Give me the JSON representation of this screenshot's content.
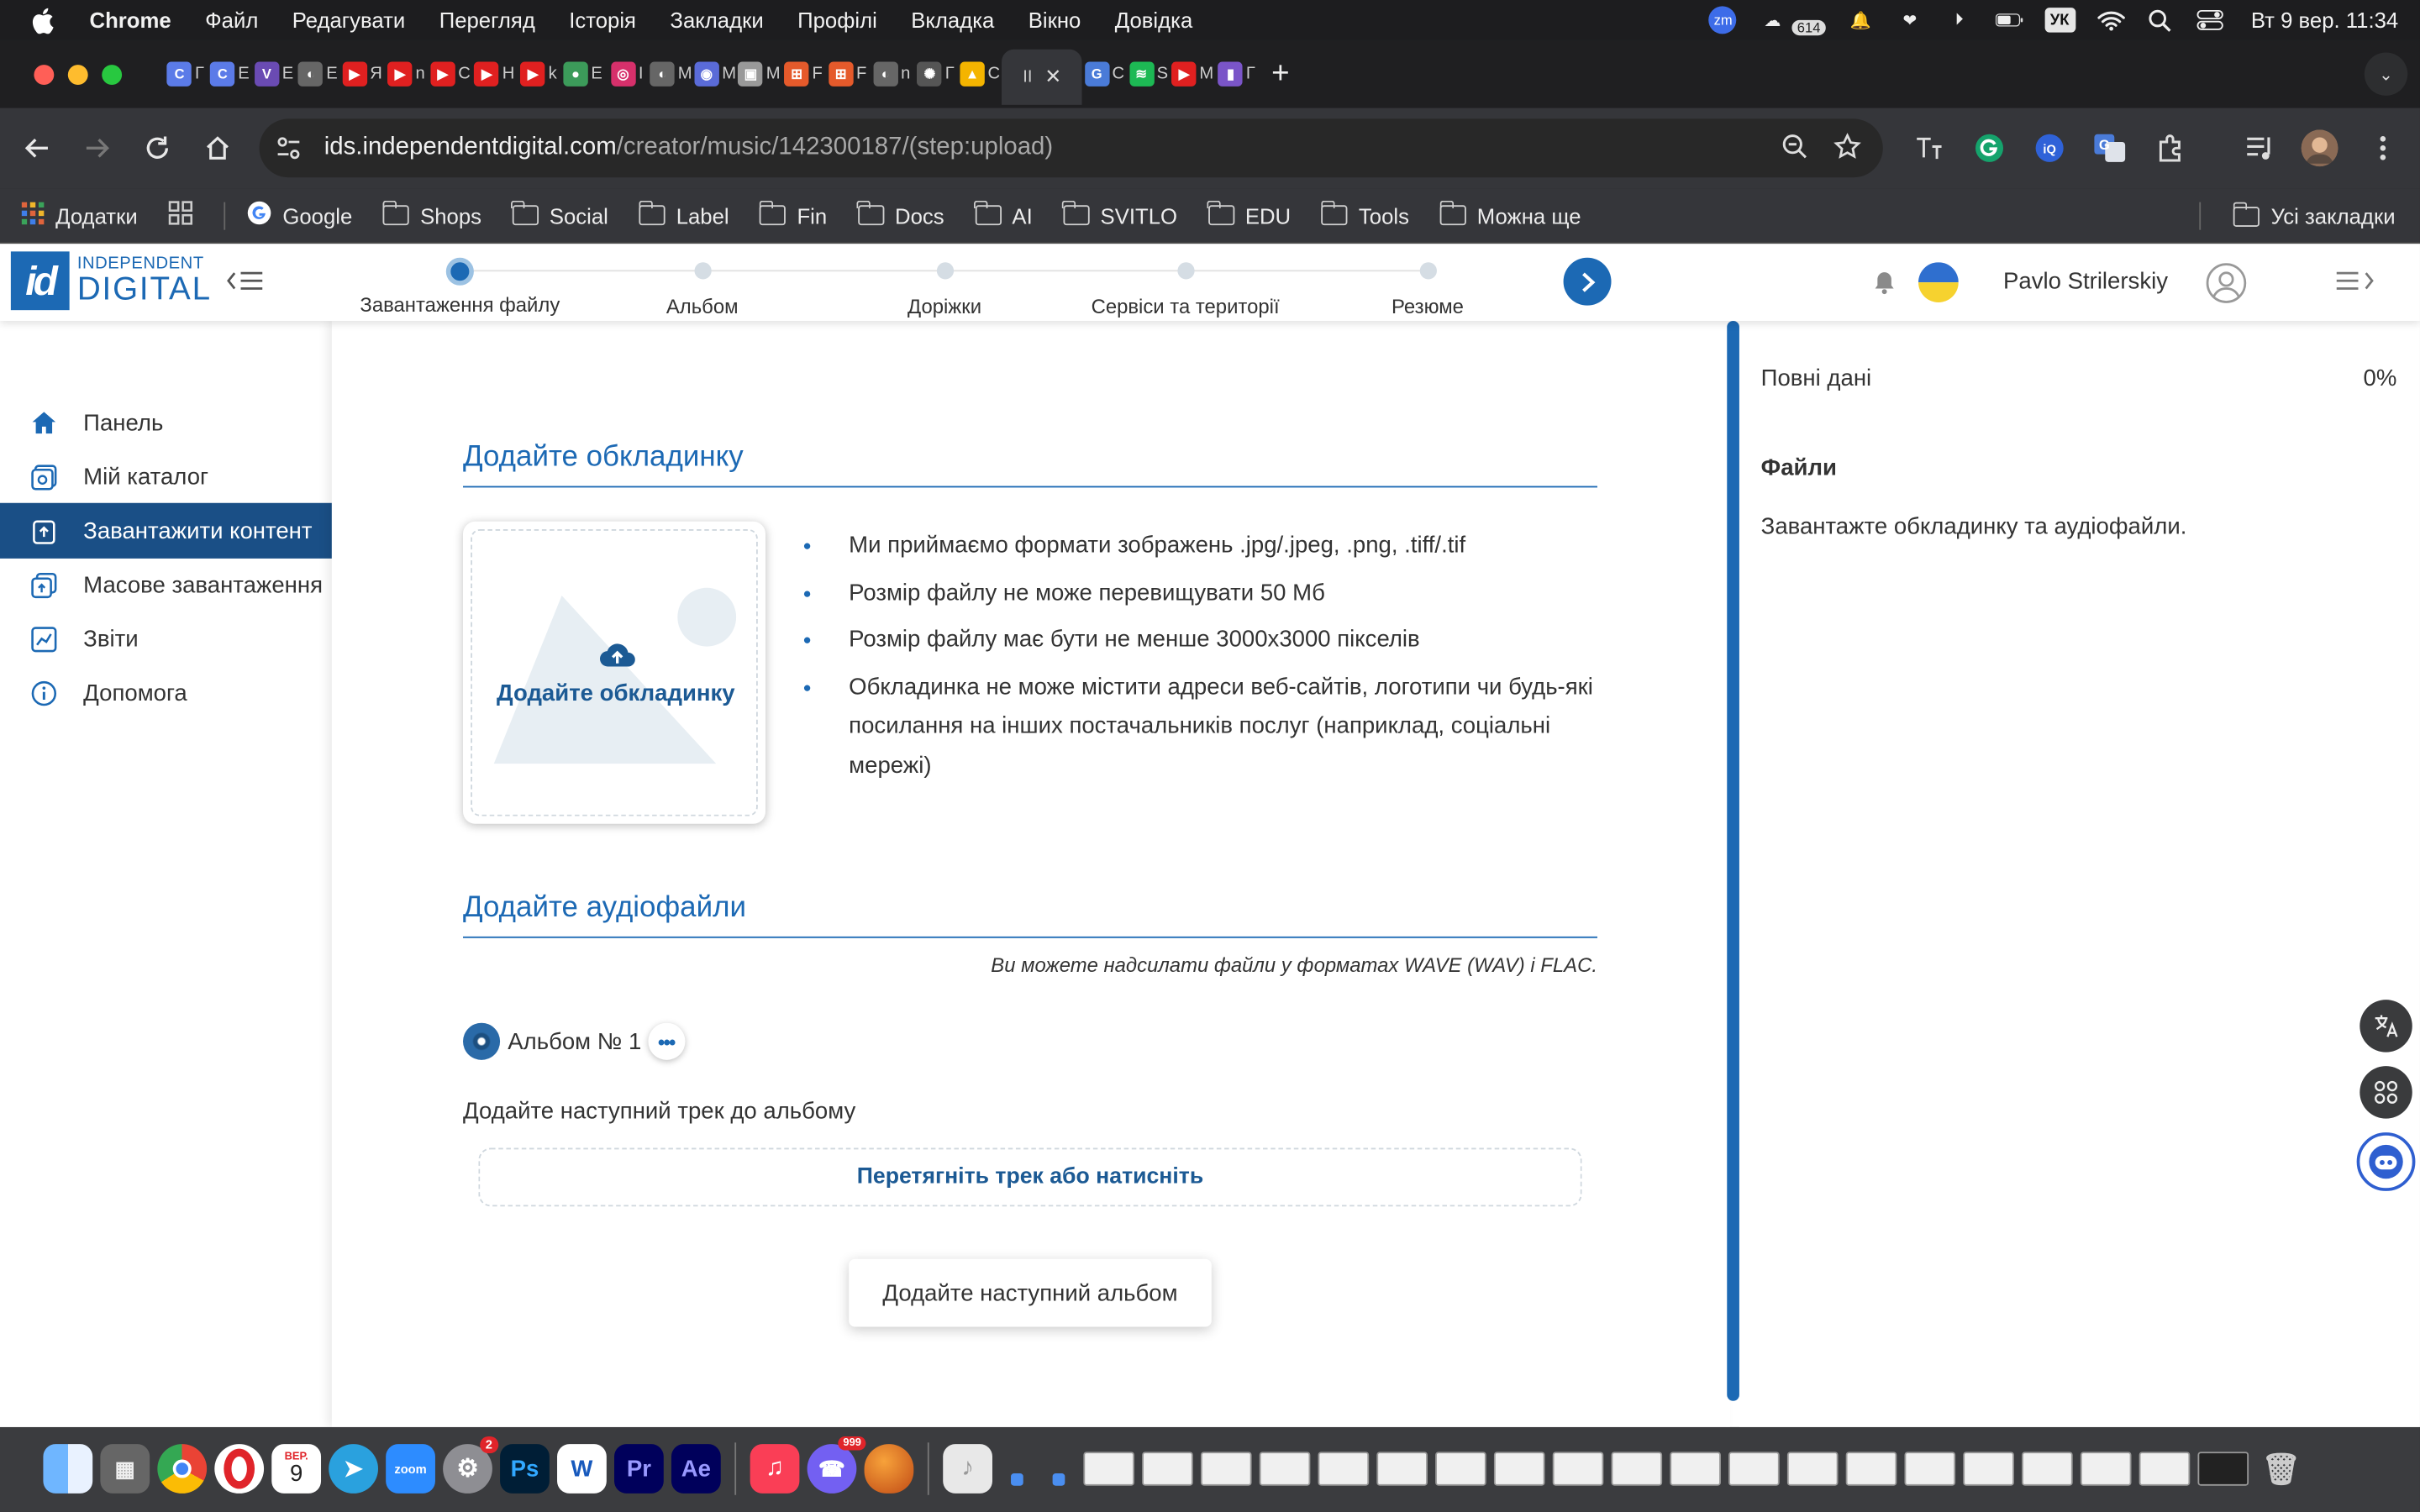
{
  "menubar": {
    "app": "Chrome",
    "items": [
      "Файл",
      "Редагувати",
      "Перегляд",
      "Історія",
      "Закладки",
      "Профілі",
      "Вкладка",
      "Вікно",
      "Довідка"
    ],
    "zoom_icon_text": "zm",
    "notif_count": "614",
    "keyboard_layout": "УК",
    "clock": "Вт 9 вер.  11:34"
  },
  "tabs": [
    {
      "icon": "chatgpt-like",
      "color": "#5b7be8",
      "glyph": "C",
      "letter": "Г"
    },
    {
      "icon": "chatgpt-like",
      "color": "#5b7be8",
      "glyph": "C",
      "letter": "E"
    },
    {
      "icon": "v-logo",
      "color": "#6a4bb3",
      "glyph": "V",
      "letter": "E"
    },
    {
      "icon": "globe",
      "color": "#666",
      "glyph": "◐",
      "letter": "E"
    },
    {
      "icon": "youtube",
      "color": "#e02020",
      "glyph": "▶",
      "letter": "Я"
    },
    {
      "icon": "youtube",
      "color": "#e02020",
      "glyph": "▶",
      "letter": "n"
    },
    {
      "icon": "youtube",
      "color": "#e02020",
      "glyph": "▶",
      "letter": "C"
    },
    {
      "icon": "youtube",
      "color": "#e02020",
      "glyph": "▶",
      "letter": "H"
    },
    {
      "icon": "youtube",
      "color": "#e02020",
      "glyph": "▶",
      "letter": "k"
    },
    {
      "icon": "maps",
      "color": "#3c9b5a",
      "glyph": "●",
      "letter": "E"
    },
    {
      "icon": "instagram",
      "color": "#d6306b",
      "glyph": "◎",
      "letter": "I"
    },
    {
      "icon": "globe",
      "color": "#666",
      "glyph": "◐",
      "letter": "M"
    },
    {
      "icon": "bot",
      "color": "#5a6bd8",
      "glyph": "◉",
      "letter": "M"
    },
    {
      "icon": "image",
      "color": "#999",
      "glyph": "▣",
      "letter": "M"
    },
    {
      "icon": "figma-like",
      "color": "#e55a2b",
      "glyph": "⊞",
      "letter": "F"
    },
    {
      "icon": "figma-like",
      "color": "#e55a2b",
      "glyph": "⊞",
      "letter": "F"
    },
    {
      "icon": "globe",
      "color": "#666",
      "glyph": "◐",
      "letter": "n"
    },
    {
      "icon": "openai",
      "color": "#555",
      "glyph": "✺",
      "letter": "Г"
    },
    {
      "icon": "drive",
      "color": "#f4b400",
      "glyph": "▲",
      "letter": "C"
    }
  ],
  "active_tab": {
    "letter": "II",
    "close": "✕"
  },
  "tabs_after": [
    {
      "icon": "translate",
      "color": "#4a7bd8",
      "glyph": "G",
      "letter": "C"
    },
    {
      "icon": "spotify",
      "color": "#1db954",
      "glyph": "≋",
      "letter": "S"
    },
    {
      "icon": "youtube",
      "color": "#e02020",
      "glyph": "▶",
      "letter": "M"
    },
    {
      "icon": "bars",
      "color": "#7a55c8",
      "glyph": "▮",
      "letter": "Г"
    }
  ],
  "address": {
    "domain": "ids.independentdigital.com",
    "path": "/creator/music/142300187/(step:upload)"
  },
  "bookmarks": {
    "apps": "Додатки",
    "items": [
      "Google",
      "Shops",
      "Social",
      "Label",
      "Fin",
      "Docs",
      "AI",
      "SVITLO",
      "EDU",
      "Tools",
      "Можна ще"
    ],
    "all": "Усі закладки"
  },
  "app": {
    "logo_box": "id",
    "logo_line1": "INDEPENDENT",
    "logo_line2": "DIGITAL",
    "steps": [
      "Завантаження файлу",
      "Альбом",
      "Доріжки",
      "Сервіси та території",
      "Резюме"
    ],
    "current_step": 0,
    "user_name": "Pavlo Strilerskiy"
  },
  "sidebar": {
    "items": [
      "Панель",
      "Мій каталог",
      "Завантажити контент",
      "Масове завантаження",
      "Звіти",
      "Допомога"
    ],
    "active_index": 2
  },
  "main": {
    "cover_title": "Додайте обкладинку",
    "cover_button": "Додайте обкладинку",
    "requirements": [
      "Ми приймаємо формати зображень .jpg/.jpeg, .png, .tiff/.tif",
      "Розмір файлу не може перевищувати 50 Мб",
      "Розмір файлу має бути не менше 3000x3000 пікселів",
      "Обкладинка не може містити адреси веб-сайтів, логотипи чи будь-які посилання на інших постачальників послуг (наприклад, соціальні мережі)"
    ],
    "audio_title": "Додайте аудіофайли",
    "formats_note": "Ви можете надсилати файли у форматах WAVE (WAV) і FLAC.",
    "album_name": "Альбом № 1",
    "album_more": "•••",
    "next_track_label": "Додайте наступний трек до альбому",
    "dropzone": "Перетягніть трек або натисніть",
    "add_album": "Додайте наступний альбом"
  },
  "right_panel": {
    "full_data": "Повні дані",
    "percent": "0%",
    "files_heading": "Файли",
    "files_text": "Завантажте обкладинку та аудіофайли."
  },
  "dock": {
    "calendar_month": "ВЕР.",
    "calendar_day": "9",
    "zoom": "zoom",
    "settings_badge": "2",
    "viber_badge": "999",
    "apps": [
      "Ps",
      "W",
      "Pr",
      "Ae"
    ]
  }
}
